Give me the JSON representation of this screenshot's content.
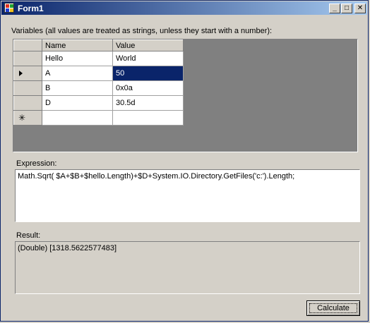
{
  "window": {
    "title": "Form1",
    "minimize_glyph": "_",
    "maximize_glyph": "□",
    "close_glyph": "✕"
  },
  "variables": {
    "label": "Variables (all values are treated as strings, unless they start with a number):",
    "columns": [
      "Name",
      "Value"
    ],
    "rows": [
      {
        "name": "Hello",
        "value": "World"
      },
      {
        "name": "A",
        "value": "50"
      },
      {
        "name": "B",
        "value": "0x0a"
      },
      {
        "name": "D",
        "value": "30.5d"
      }
    ],
    "new_row_glyph": "✳",
    "current_row_index": 1
  },
  "expression": {
    "label": "Expression:",
    "value": "Math.Sqrt( $A+$B+$hello.Length)+$D+System.IO.Directory.GetFiles('c:').Length;"
  },
  "result": {
    "label": "Result:",
    "value": "(Double) [1318.5622577483]"
  },
  "calculate_button": {
    "label": "Calculate"
  },
  "colors": {
    "selection": "#0a246a",
    "window_face": "#d4d0c8",
    "grid_background": "#808080"
  }
}
